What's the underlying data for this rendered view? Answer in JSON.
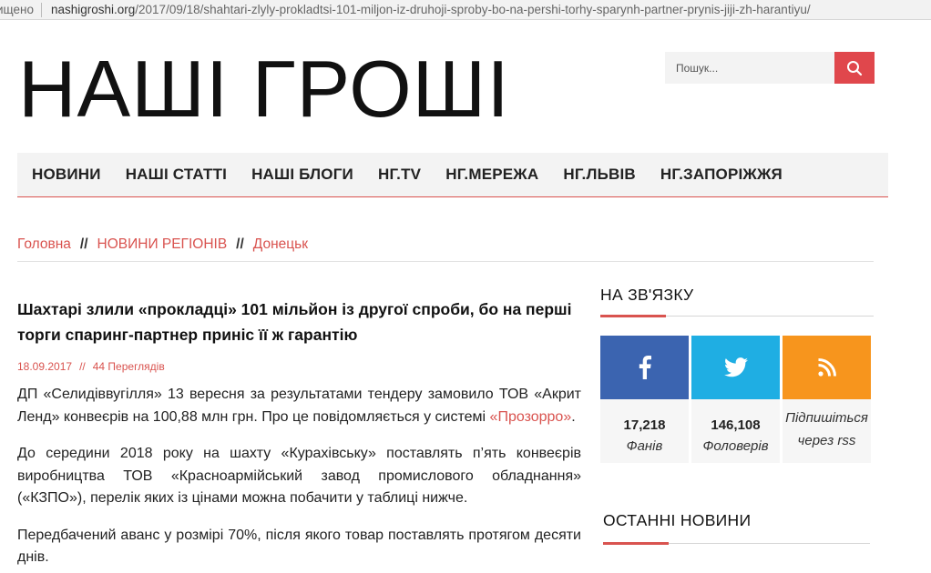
{
  "browser": {
    "secure_label": "ищено",
    "url_host": "nashigroshi.org",
    "url_path": "/2017/09/18/shahtari-zlyly-prokladtsi-101-miljon-iz-druhoji-sproby-bo-na-pershi-torhy-sparynh-partner-prynis-jiji-zh-harantiyu/"
  },
  "site": {
    "logo": "НАШІ ГРОШІ",
    "search_placeholder": "Пошук..."
  },
  "nav": [
    "НОВИНИ",
    "НАШІ СТАТТІ",
    "НАШІ БЛОГИ",
    "НГ.TV",
    "НГ.МЕРЕЖА",
    "НГ.ЛЬВІВ",
    "НГ.ЗАПОРІЖЖЯ"
  ],
  "breadcrumb": {
    "home": "Головна",
    "separator": "//",
    "section": "НОВИНИ РЕГІОНІВ",
    "region": "Донецьк"
  },
  "article": {
    "title": "Шахтарі злили «прокладці» 101 мільйон із другої спроби, бо на перші торги спаринг-партнер приніс її ж гарантію",
    "date": "18.09.2017",
    "meta_sep": "//",
    "views": "44 Переглядів",
    "p1_before": "ДП «Селидіввугілля» 13 вересня за результатами тендеру замовило ТОВ «Акрит Ленд» конвеєрів на 100,88 млн грн. Про це повідомляється у системі ",
    "p1_link": "«Прозорро»",
    "p1_after": ".",
    "p2": "До середини 2018 року на шахту «Курахівську» поставлять п’ять конвеєрів виробництва ТОВ «Красноармійський завод промислового обладнання» («КЗПО»), перелік яких із цінами можна побачити у таблиці нижче.",
    "p3": "Передбачений аванс у розмірі 70%, після якого товар поставлять протягом десяти днів."
  },
  "sidebar": {
    "contact_title": "НА ЗВ'ЯЗКУ",
    "facebook": {
      "count": "17,218",
      "label": "Фанів",
      "color": "#3b64b0"
    },
    "twitter": {
      "count": "146,108",
      "label": "Фоловерів",
      "color": "#1faee3"
    },
    "rss": {
      "label_line1": "Підпишіться",
      "label_line2": "через rss",
      "color": "#f7951d"
    },
    "latest_title": "ОСТАННІ НОВИНИ"
  },
  "colors": {
    "accent": "#d9534f",
    "search_button": "#e0474c"
  }
}
